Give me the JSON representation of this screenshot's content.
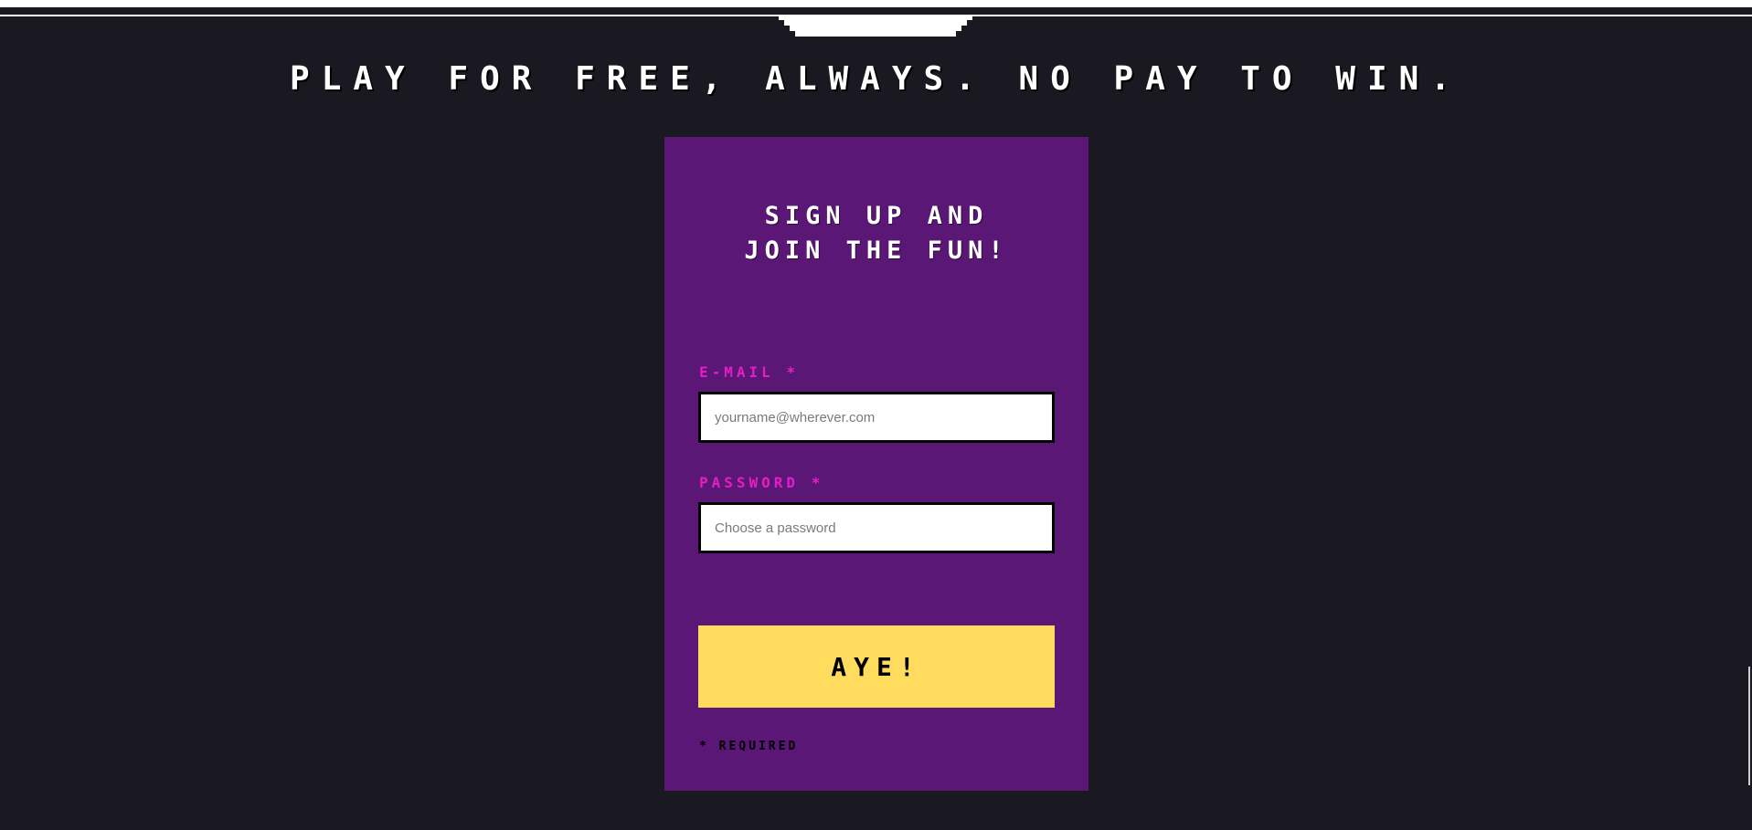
{
  "headline": "PLAY FOR FREE, ALWAYS. NO PAY TO WIN.",
  "signup": {
    "title": "SIGN UP AND JOIN THE FUN!",
    "email": {
      "label": "E-MAIL *",
      "value": "",
      "placeholder": "yourname@wherever.com"
    },
    "password": {
      "label": "PASSWORD *",
      "value": "",
      "placeholder": "Choose a password"
    },
    "submit_label": "AYE!",
    "required_note": "* REQUIRED"
  },
  "colors": {
    "page_background": "#1a1820",
    "card_background": "#5a1775",
    "label_accent": "#e31ec4",
    "button_background": "#ffdc5e",
    "text_light": "#ffffff"
  }
}
